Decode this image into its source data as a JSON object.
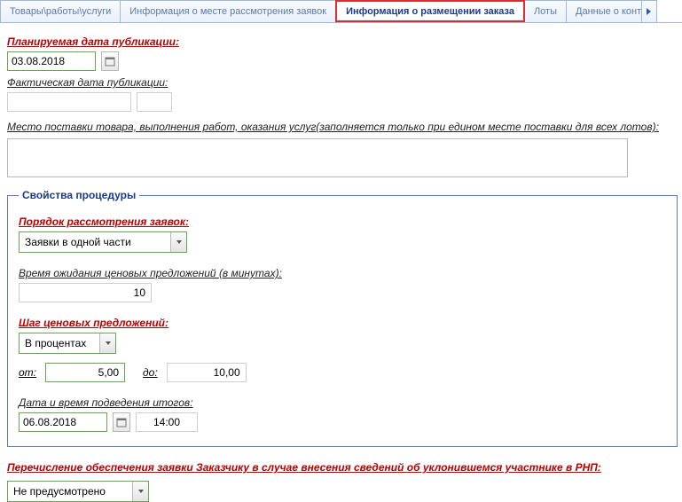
{
  "tabs": {
    "t1": "Товары\\работы\\услуги",
    "t2": "Информация о месте рассмотрения заявок",
    "t3": "Информация о размещении заказа",
    "t4": "Лоты",
    "t5": "Данные о конт"
  },
  "labels": {
    "planned_pub": "Планируемая дата публикации:",
    "actual_pub": "Фактическая дата публикации:",
    "delivery_place": "Место поставки товара, выполнения работ, оказания услуг(заполняется только при едином месте поставки для всех лотов):",
    "fieldset_title": "Свойства процедуры",
    "review_order": "Порядок рассмотрения заявок:",
    "wait_time": "Время ожидания ценовых предложений (в минутах):",
    "price_step": "Шаг ценовых предложений:",
    "from": "от:",
    "to": "до:",
    "results_date": "Дата и время подведения итогов:",
    "transfer_security": "Перечисление обеспечения заявки Заказчику в случае внесения сведений об уклонившемся участнике в РНП:"
  },
  "values": {
    "planned_date": "03.08.2018",
    "review_select": "Заявки в одной части",
    "wait_minutes": "10",
    "step_type": "В процентах",
    "from_val": "5,00",
    "to_val": "10,00",
    "results_date": "06.08.2018",
    "results_time": "14:00",
    "security_select": "Не предусмотрено"
  }
}
